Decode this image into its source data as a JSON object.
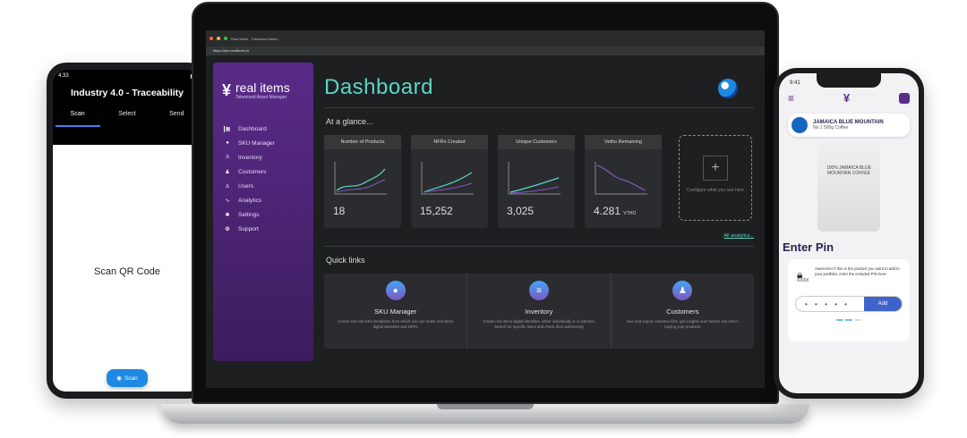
{
  "android": {
    "status_time": "4:33",
    "app_title": "Industry 4.0 - Traceability",
    "tabs": [
      "Scan",
      "Select",
      "Send"
    ],
    "body_text": "Scan QR Code",
    "scan_button": "Scan"
  },
  "browser": {
    "tab_title": "Real Items - Tokenized Asset...",
    "url": "https://tam.realitems.io"
  },
  "sidebar": {
    "logo_name": "real items",
    "logo_sub": "Tokenized Asset Manager",
    "items": [
      {
        "label": "Dashboard",
        "icon": "grid-icon",
        "glyph": "▦"
      },
      {
        "label": "SKU Manager",
        "icon": "bulb-icon",
        "glyph": "●"
      },
      {
        "label": "Inventory",
        "icon": "list-icon",
        "glyph": "≡"
      },
      {
        "label": "Customers",
        "icon": "people-icon",
        "glyph": "♟"
      },
      {
        "label": "Users",
        "icon": "user-icon",
        "glyph": "♙"
      },
      {
        "label": "Analytics",
        "icon": "chart-icon",
        "glyph": "∿"
      },
      {
        "label": "Settings",
        "icon": "gear-icon",
        "glyph": "✱"
      },
      {
        "label": "Support",
        "icon": "support-icon",
        "glyph": "❂"
      }
    ]
  },
  "main": {
    "title": "Dashboard",
    "glance_title": "At a glance...",
    "cards": [
      {
        "title": "Number of Products",
        "value": "18",
        "unit": ""
      },
      {
        "title": "NFRs Created",
        "value": "15,252",
        "unit": ""
      },
      {
        "title": "Unique Customers",
        "value": "3,025",
        "unit": ""
      },
      {
        "title": "Vetho Remaining",
        "value": "4.281",
        "unit": "VTHO"
      }
    ],
    "configure_text": "Configure what you see here",
    "all_analytics": "All analytics...",
    "quick_title": "Quick links",
    "quick": [
      {
        "title": "SKU Manager",
        "desc": "Create and edit SKU templates from which you can make real items digital identities and NFRs"
      },
      {
        "title": "Inventory",
        "desc": "Create real items digital identities, either individually or in batches. Search for specific items and check their authenticity"
      },
      {
        "title": "Customers",
        "desc": "See and export customer lists, get insights and metrics into who's buying your products"
      }
    ]
  },
  "iphone": {
    "status_time": "9:41",
    "product_name": "JAMAICA BLUE MOUNTAIN",
    "product_sub": "No.1 500g Coffee",
    "bag_text": "100% JAMAICA BLUE MOUNTAIN COFFEE",
    "pin_title": "Enter Pin",
    "pin_desc": "Awesome! If this is the product you want to add to your portfolio, enter the included PIN here:",
    "pin_mask": "XXXX",
    "pin_placeholder": "• • • • • •",
    "add_button": "Add"
  }
}
